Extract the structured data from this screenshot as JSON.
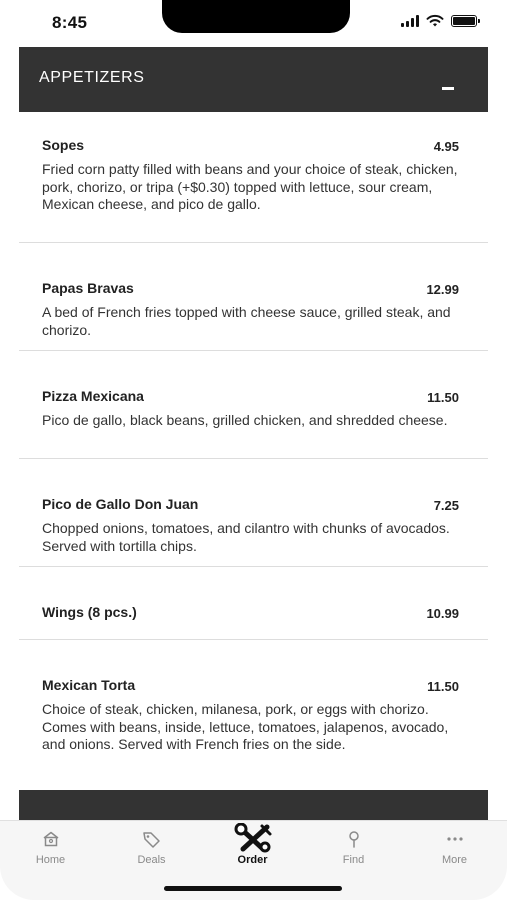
{
  "status_bar": {
    "time": "8:45"
  },
  "section": {
    "title": "APPETIZERS",
    "collapse_icon": "minus-icon"
  },
  "menu_items": [
    {
      "name": "Sopes",
      "price": "4.95",
      "description": "Fried corn patty filled with beans and your choice of steak, chicken, pork, chorizo, or tripa (+$0.30) topped with lettuce, sour cream, Mexican cheese, and pico de gallo."
    },
    {
      "name": "Papas Bravas",
      "price": "12.99",
      "description": "A bed of French fries topped with cheese sauce, grilled steak, and chorizo."
    },
    {
      "name": "Pizza Mexicana",
      "price": "11.50",
      "description": "Pico de gallo, black beans, grilled chicken, and shredded cheese."
    },
    {
      "name": "Pico de Gallo Don Juan",
      "price": "7.25",
      "description": "Chopped onions, tomatoes, and cilantro with chunks of avocados. Served with tortilla chips."
    },
    {
      "name": "Wings (8 pcs.)",
      "price": "10.99",
      "description": ""
    },
    {
      "name": "Mexican Torta",
      "price": "11.50",
      "description": "Choice of steak, chicken, milanesa, pork, or eggs with chorizo. Comes with beans, inside, lettuce, tomatoes, jalapenos, avocado, and onions. Served with French fries on the side."
    }
  ],
  "tab_bar": {
    "tabs": [
      {
        "label": "Home",
        "icon": "home-icon"
      },
      {
        "label": "Deals",
        "icon": "tag-icon"
      },
      {
        "label": "Order",
        "icon": "utensils-icon",
        "active": true
      },
      {
        "label": "Find",
        "icon": "location-pin-icon"
      },
      {
        "label": "More",
        "icon": "more-dots-icon"
      }
    ]
  },
  "colors": {
    "header_bg": "#333333",
    "tab_bar_bg": "#f6f6f6",
    "divider": "#dddddd"
  }
}
